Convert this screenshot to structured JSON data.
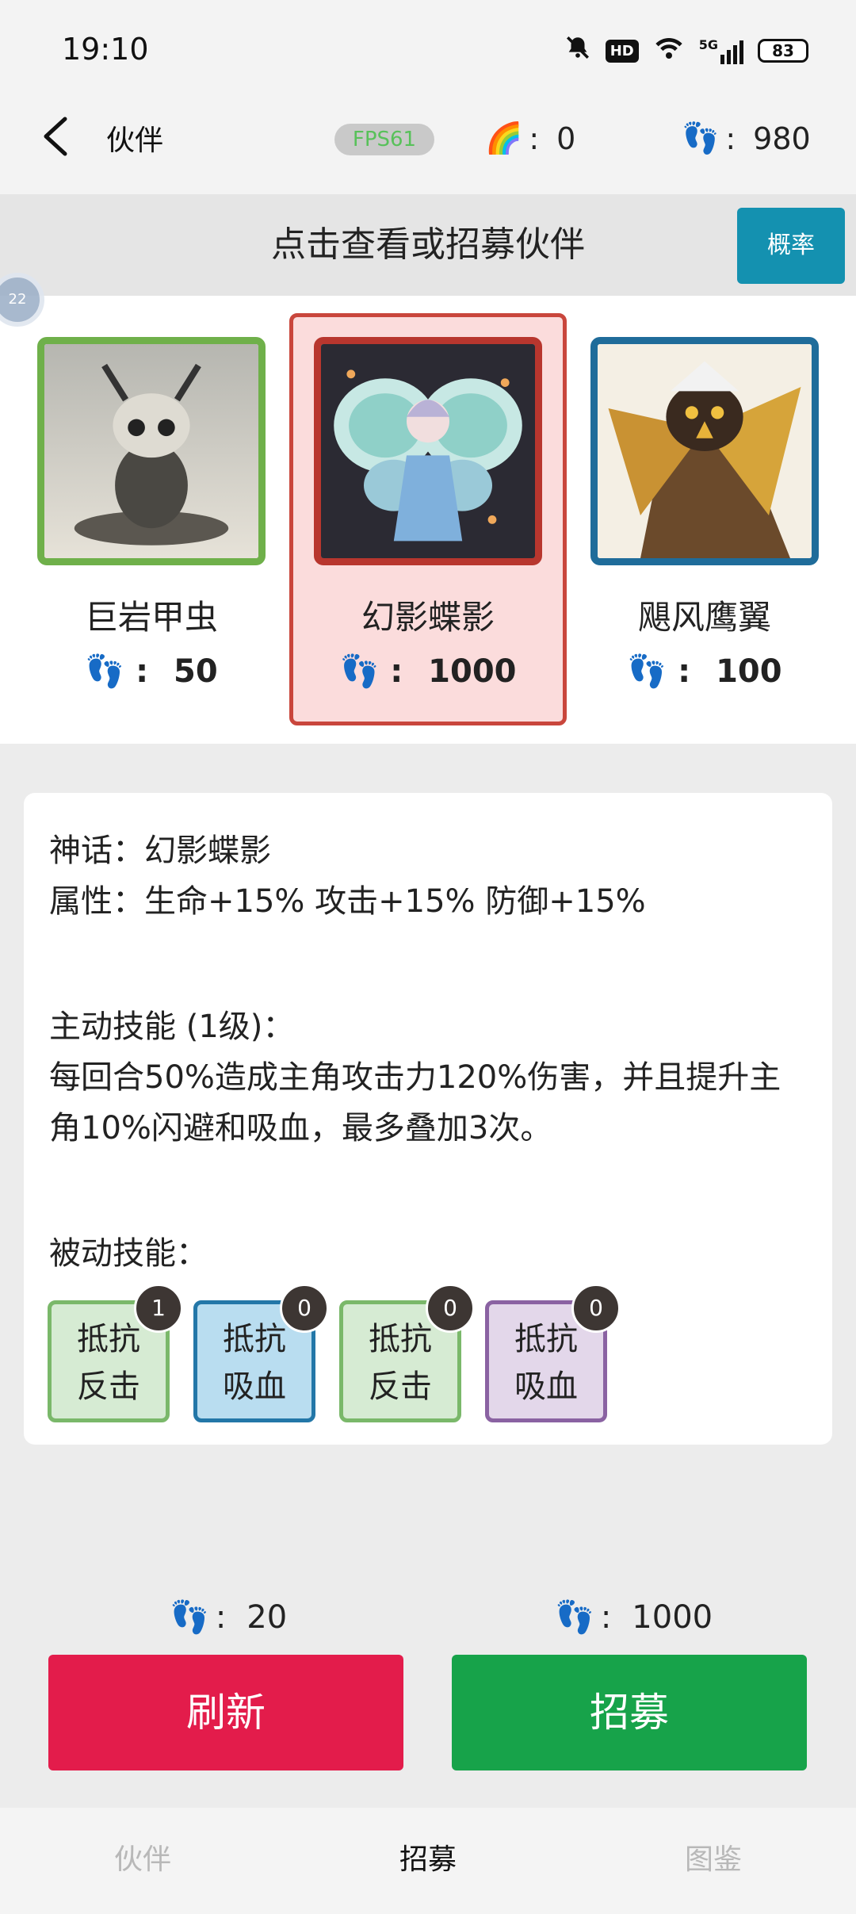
{
  "status_bar": {
    "time": "19:10",
    "network": "5G",
    "battery": "83"
  },
  "header": {
    "title": "伙伴",
    "fps": "FPS61",
    "rainbow_icon": "🌈",
    "rainbow_value": "0",
    "steps_icon": "👣",
    "steps_value": "980"
  },
  "banner": {
    "text": "点击查看或招募伙伴",
    "prob_label": "概率"
  },
  "floating_ball": {
    "label": "22"
  },
  "partners": [
    {
      "name": "巨岩甲虫",
      "cost": "50",
      "border": "#6fb04a",
      "selected": false
    },
    {
      "name": "幻影蝶影",
      "cost": "1000",
      "border": "#b8362e",
      "selected": true
    },
    {
      "name": "飓风鹰翼",
      "cost": "100",
      "border": "#1f6c9a",
      "selected": false
    }
  ],
  "detail": {
    "rarity_line": "神话：幻影蝶影",
    "attr_line": "属性：生命+15% 攻击+15% 防御+15%",
    "active_title": "主动技能 (1级)：",
    "active_desc_1": "每回合50%造成主角攻击力120%伤害，并且提升主",
    "active_desc_2": "角10%闪避和吸血，最多叠加3次。",
    "passive_title": "被动技能：",
    "passives": [
      {
        "line1": "抵抗",
        "line2": "反击",
        "count": "1",
        "bg": "#d6ebd3",
        "border": "#7ab86a"
      },
      {
        "line1": "抵抗",
        "line2": "吸血",
        "count": "0",
        "bg": "#b9ddf0",
        "border": "#2377a8"
      },
      {
        "line1": "抵抗",
        "line2": "反击",
        "count": "0",
        "bg": "#d6ebd3",
        "border": "#7ab86a"
      },
      {
        "line1": "抵抗",
        "line2": "吸血",
        "count": "0",
        "bg": "#e3d7ea",
        "border": "#8a62a2"
      }
    ]
  },
  "actions": {
    "refresh_cost": "20",
    "refresh_label": "刷新",
    "recruit_cost": "1000",
    "recruit_label": "招募"
  },
  "tabs": [
    {
      "label": "伙伴",
      "active": false
    },
    {
      "label": "招募",
      "active": true
    },
    {
      "label": "图鉴",
      "active": false
    }
  ]
}
